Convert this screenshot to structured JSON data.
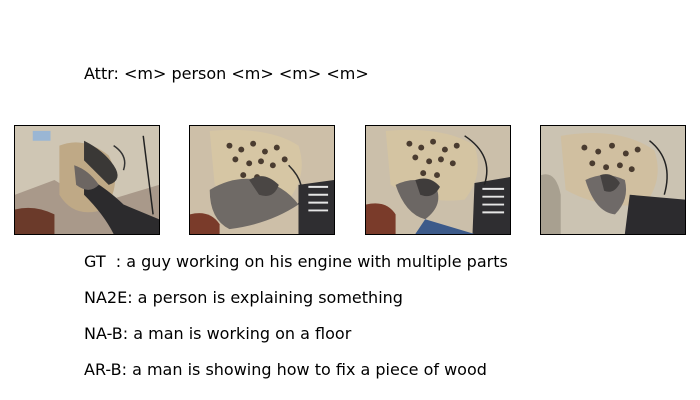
{
  "attr": {
    "text": "Attr: <m> person <m> <m> <m>"
  },
  "frames": [
    {
      "alt": "video frame 1: gloved hand over engine parts on floor"
    },
    {
      "alt": "video frame 2: gloved hand over engine parts on floor"
    },
    {
      "alt": "video frame 3: gloved hand over engine parts on floor"
    },
    {
      "alt": "video frame 4: gloved hand over engine parts on floor"
    }
  ],
  "captions": [
    {
      "text": "GT  : a guy working on his engine with multiple parts"
    },
    {
      "text": "NA2E: a person is explaining something"
    },
    {
      "text": "NA-B: a man is working on a floor"
    },
    {
      "text": "AR-B: a man is showing how to fix a piece of wood"
    }
  ]
}
